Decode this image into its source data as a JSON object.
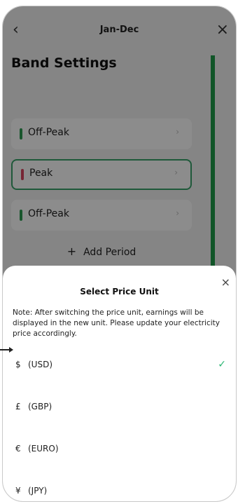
{
  "header": {
    "title": "Jan-Dec",
    "back_icon": "chevron-left-icon",
    "close_icon": "close-icon"
  },
  "band_settings": {
    "title": "Band Settings",
    "rows": [
      {
        "name": "Off-Peak",
        "color": "#2e9d52"
      },
      {
        "name": "Peak",
        "color": "#d9455f"
      },
      {
        "name": "Off-Peak",
        "color": "#2e9d52"
      }
    ],
    "add_period_label": "Add Period"
  },
  "sheet": {
    "title": "Select Price Unit",
    "note": "Note: After switching the price unit, earnings will be displayed in the new unit. Please update your electricity price accordingly.",
    "options": [
      {
        "symbol": "$",
        "label": "(USD)",
        "selected": true
      },
      {
        "symbol": "£",
        "label": "(GBP)",
        "selected": false
      },
      {
        "symbol": "€",
        "label": "(EURO)",
        "selected": false
      },
      {
        "symbol": "¥",
        "label": "(JPY)",
        "selected": false
      }
    ],
    "accent": "#2bb673"
  }
}
